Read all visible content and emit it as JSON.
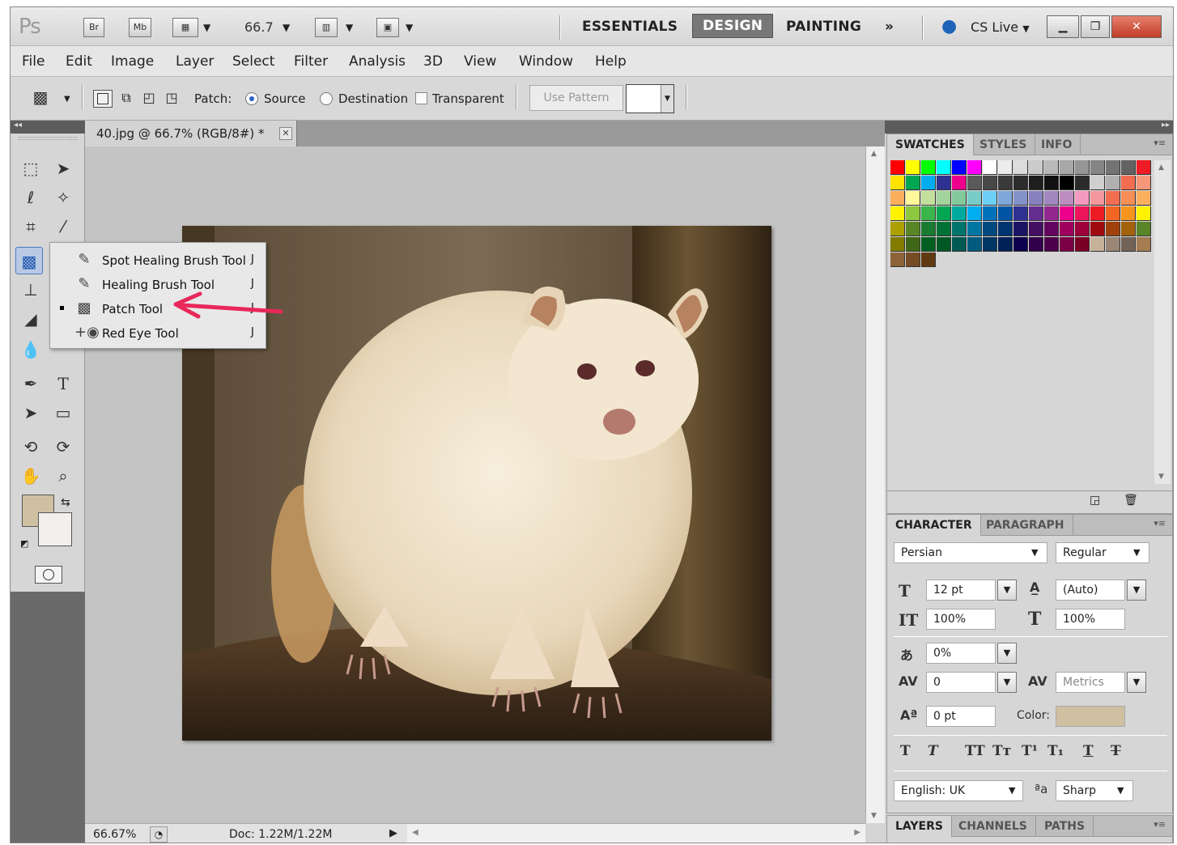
{
  "appbar": {
    "logo": "Ps",
    "bridge_label": "Br",
    "minibridge_label": "Mb",
    "zoom": "66.7",
    "workspaces": [
      "ESSENTIALS",
      "DESIGN",
      "PAINTING"
    ],
    "more": "»",
    "cslive": "CS Live"
  },
  "menu": [
    "File",
    "Edit",
    "Image",
    "Layer",
    "Select",
    "Filter",
    "Analysis",
    "3D",
    "View",
    "Window",
    "Help"
  ],
  "options": {
    "patch_label": "Patch:",
    "source_label": "Source",
    "destination_label": "Destination",
    "transparent_label": "Transparent",
    "use_pattern_label": "Use Pattern",
    "source_selected": true
  },
  "doc": {
    "tab_title": "40.jpg @ 66.7% (RGB/8#) *",
    "status_zoom": "66.67%",
    "status_doc": "Doc: 1.22M/1.22M"
  },
  "flyout": {
    "items": [
      {
        "label": "Spot Healing Brush Tool",
        "key": "J",
        "active": false
      },
      {
        "label": "Healing Brush Tool",
        "key": "J",
        "active": false
      },
      {
        "label": "Patch Tool",
        "key": "J",
        "active": true
      },
      {
        "label": "Red Eye Tool",
        "key": "J",
        "active": false
      }
    ]
  },
  "colors": {
    "foreground": "#cfc0a2",
    "background": "#f2efec",
    "arrow": "#e8285a"
  },
  "swatches_panel": {
    "tabs": [
      "SWATCHES",
      "STYLES",
      "INFO"
    ]
  },
  "character_panel": {
    "tabs": [
      "CHARACTER",
      "PARAGRAPH"
    ],
    "font_family": "Persian",
    "font_style": "Regular",
    "font_size": "12 pt",
    "leading": "(Auto)",
    "vertical_scale": "100%",
    "horizontal_scale": "100%",
    "tsume": "0%",
    "kerning": "0",
    "tracking": "Metrics",
    "baseline_shift": "0 pt",
    "color_label": "Color:",
    "color_value": "#cfc0a2",
    "language": "English: UK",
    "aa_label": "ªa",
    "antialias": "Sharp"
  },
  "bottom_panel": {
    "tabs": [
      "LAYERS",
      "CHANNELS",
      "PATHS"
    ]
  }
}
